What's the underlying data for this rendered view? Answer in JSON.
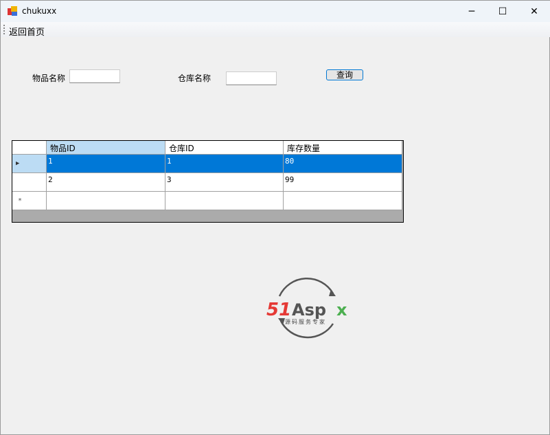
{
  "window": {
    "title": "chukuxx",
    "minimize": "─",
    "maximize": "☐",
    "close": "✕"
  },
  "menu": {
    "back_home": "返回首页"
  },
  "search": {
    "item_name_label": "物品名称",
    "item_name_value": "",
    "warehouse_name_label": "仓库名称",
    "warehouse_name_value": "",
    "query_button": "查询"
  },
  "grid": {
    "columns": [
      "物品ID",
      "仓库ID",
      "库存数量"
    ],
    "rows": [
      [
        "1",
        "1",
        "80"
      ],
      [
        "2",
        "3",
        "99"
      ]
    ],
    "selected_row": 0,
    "current_row_marker": "▶",
    "new_row_marker": "*"
  },
  "logo": {
    "text": "51Aspx",
    "tagline": "源码服务专家",
    "colors": {
      "five_one": "#e53935",
      "aspx": "#555555",
      "x": "#4caf50"
    }
  }
}
